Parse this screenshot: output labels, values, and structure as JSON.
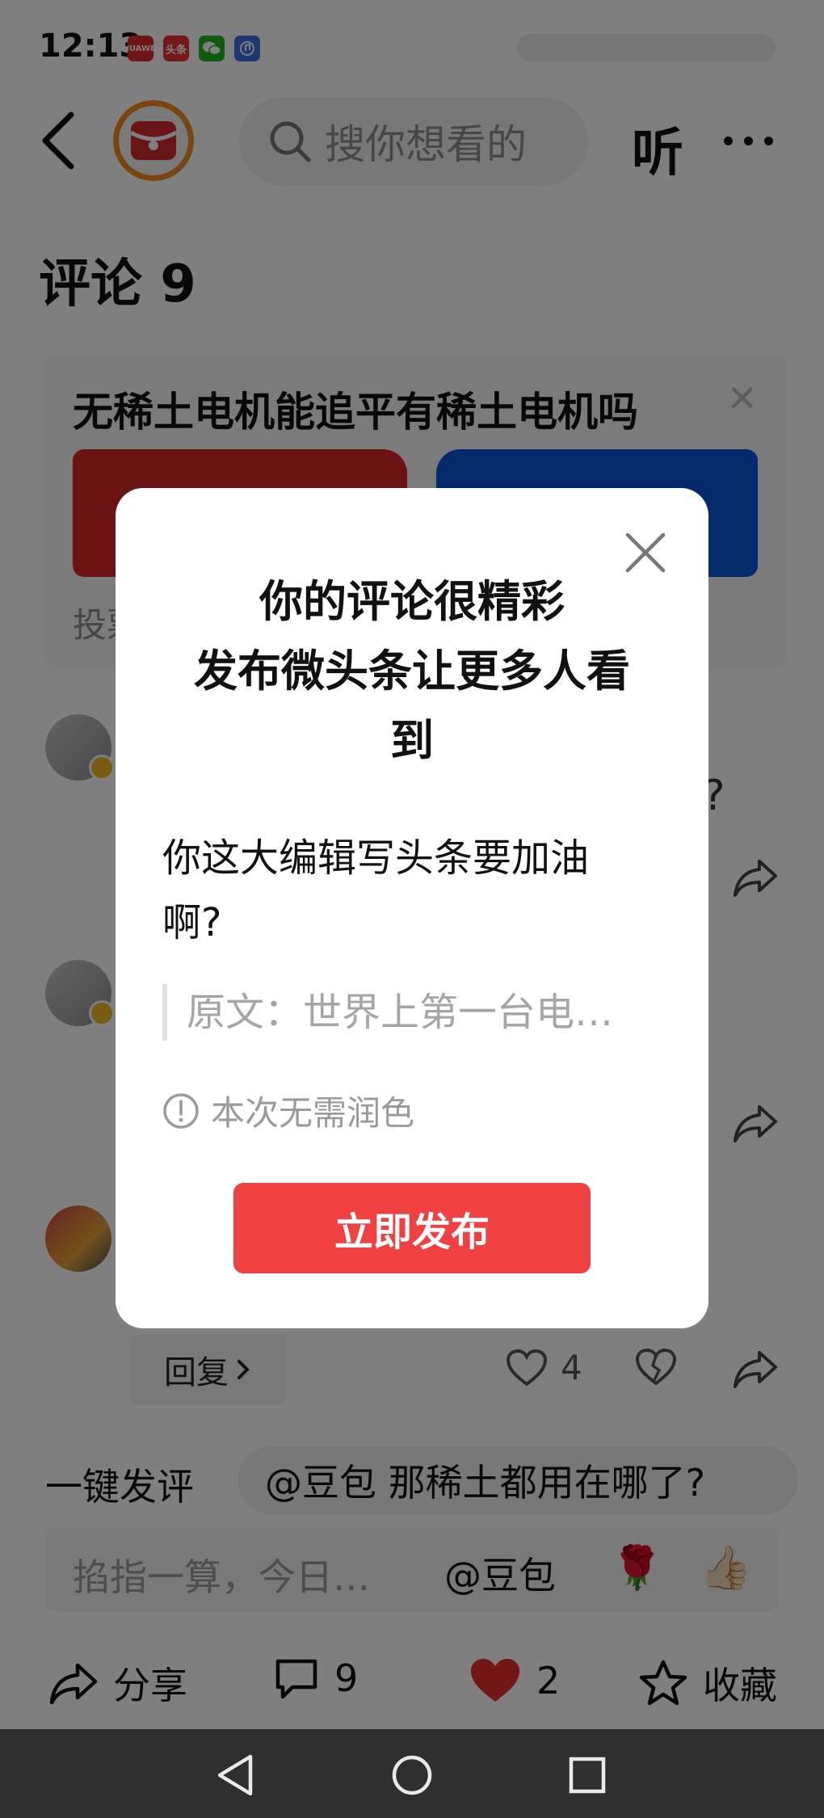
{
  "status_bar": {
    "time": "12:13",
    "apps": [
      {
        "name": "huawei-app-icon",
        "label": "HUAWEI",
        "color": "#e02b2b"
      },
      {
        "name": "toutiao-app-icon",
        "label": "头条",
        "color": "#e8332f"
      },
      {
        "name": "wechat-app-icon",
        "label": "",
        "color": "#1fb922"
      },
      {
        "name": "music-app-icon",
        "label": "",
        "color": "#3b6fe0"
      }
    ]
  },
  "header": {
    "search_placeholder": "搜你想看的",
    "listen_label": "听"
  },
  "comments": {
    "title": "评论 9",
    "stray_char": "?"
  },
  "poll": {
    "question": "无稀土电机能追平有稀土电机吗",
    "footer": "投票",
    "colors": {
      "option_a": "#d62626",
      "option_b": "#0a55d6"
    }
  },
  "comment_actions": {
    "reply_label": "回复",
    "like_count": "4"
  },
  "quick_comment": {
    "label": "一键发评",
    "suggestion": "@豆包 那稀土都用在哪了?"
  },
  "comment_input": {
    "placeholder": "掐指一算，今日…",
    "mention": "@豆包",
    "emoji_rose": "🌹",
    "emoji_thumb": "👍🏻"
  },
  "action_bar": {
    "share_label": "分享",
    "comment_count": "9",
    "like_count": "2",
    "favorite_label": "收藏"
  },
  "dialog": {
    "title": "你的评论很精彩\n发布微头条让更多人看\n到",
    "comment_text": "你这大编辑写头条要加油啊?",
    "quote_text": "原文：世界上第一台电…",
    "tip_text": "本次无需润色",
    "publish_label": "立即发布",
    "accent_color": "#f04142"
  }
}
